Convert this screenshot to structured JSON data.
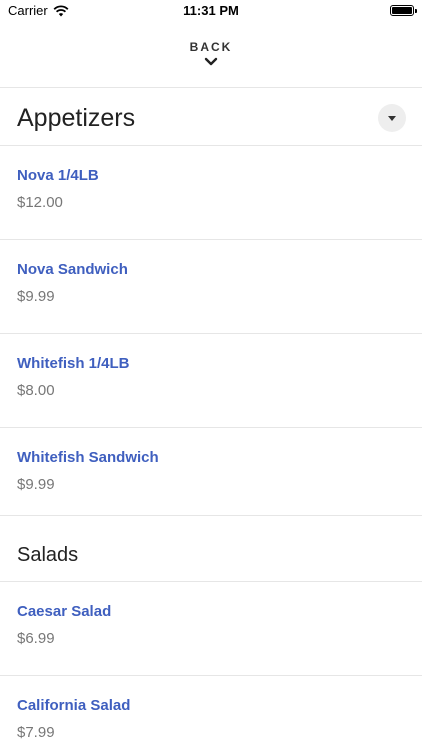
{
  "status_bar": {
    "carrier": "Carrier",
    "time": "11:31 PM",
    "wifi_icon": "wifi-icon",
    "battery_icon": "battery-icon"
  },
  "nav": {
    "back_label": "BACK",
    "back_icon": "chevron-down-icon"
  },
  "sections": [
    {
      "title": "Appetizers",
      "dropdown_icon": "caret-down-icon",
      "items": [
        {
          "name": "Nova 1/4LB",
          "price": "$12.00"
        },
        {
          "name": "Nova Sandwich",
          "price": "$9.99"
        },
        {
          "name": "Whitefish 1/4LB",
          "price": "$8.00"
        },
        {
          "name": "Whitefish Sandwich",
          "price": "$9.99"
        }
      ]
    },
    {
      "title": "Salads",
      "items": [
        {
          "name": "Caesar Salad",
          "price": "$6.99"
        },
        {
          "name": "California Salad",
          "price": "$7.99"
        }
      ]
    }
  ],
  "colors": {
    "item_name": "#3f5fbf",
    "price": "#777777",
    "divider": "#e6e6e6"
  }
}
